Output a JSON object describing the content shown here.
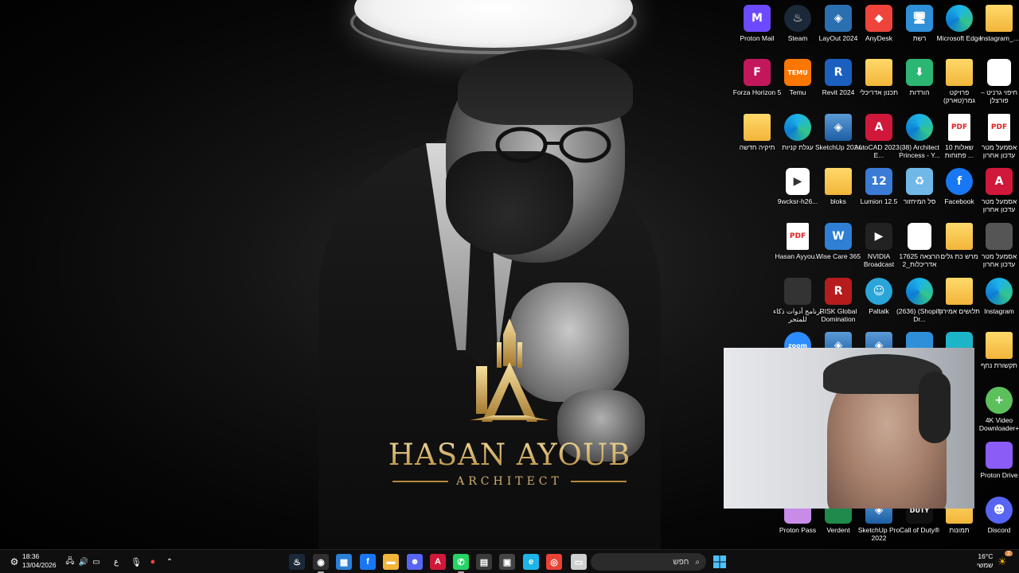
{
  "wallpaper": {
    "logo_name": "HASAN AYOUB",
    "logo_sub": "ARCHITECT",
    "accent_gold": "#d1ad6b"
  },
  "desktop_icons": [
    {
      "label": "Proton Mail",
      "icon": "proton-mail-icon",
      "color": "#6d4aff",
      "glyph": "M"
    },
    {
      "label": "Steam",
      "icon": "steam-icon",
      "color": "#1b2838",
      "glyph": "♨"
    },
    {
      "label": "LayOut 2024",
      "icon": "layout-icon",
      "color": "#2a6fb0",
      "glyph": "◈"
    },
    {
      "label": "AnyDesk",
      "icon": "anydesk-icon",
      "color": "#ef443b",
      "glyph": "◆"
    },
    {
      "label": "רשת",
      "icon": "network-icon",
      "color": "#2f8fd8",
      "glyph": "🖥"
    },
    {
      "label": "Microsoft Edge",
      "icon": "edge-icon",
      "color": "",
      "glyph": ""
    },
    {
      "label": "Instagram_...",
      "icon": "folder-icon",
      "color": "",
      "glyph": ""
    },
    {
      "label": "Forza Horizon 5",
      "icon": "forza-icon",
      "color": "#c2185b",
      "glyph": "F"
    },
    {
      "label": "Temu",
      "icon": "temu-icon",
      "color": "#fb7701",
      "glyph": "TEMU"
    },
    {
      "label": "Revit 2024",
      "icon": "revit-icon",
      "color": "#1b5fbf",
      "glyph": "R"
    },
    {
      "label": "תכנון אדריכלי",
      "icon": "folder-icon",
      "color": "",
      "glyph": ""
    },
    {
      "label": "הורדות",
      "icon": "downloads-icon",
      "color": "#2bb673",
      "glyph": "⬇"
    },
    {
      "label": "פרויקט גמר(טארק)",
      "icon": "folder-icon",
      "color": "",
      "glyph": ""
    },
    {
      "label": "חיפוי גרניט – פורצלן",
      "icon": "document-icon",
      "color": "#ffffff",
      "glyph": ""
    },
    {
      "label": "תיקיה חדשה",
      "icon": "folder-icon",
      "color": "",
      "glyph": ""
    },
    {
      "label": "עגלת קניות",
      "icon": "edge-icon",
      "color": "",
      "glyph": ""
    },
    {
      "label": "SketchUp 2024",
      "icon": "sketchup-icon",
      "color": "",
      "glyph": "◈"
    },
    {
      "label": "AutoCAD 2023 - E...",
      "icon": "autocad-icon",
      "color": "",
      "glyph": "A"
    },
    {
      "label": "(38) Architect Princess - Y...",
      "icon": "edge-icon",
      "color": "",
      "glyph": ""
    },
    {
      "label": "10 שאלות פתוחות ...",
      "icon": "pdf-icon",
      "color": "",
      "glyph": "PDF"
    },
    {
      "label": "אסמעל מטר עדכון אחרון",
      "icon": "pdf-icon",
      "color": "",
      "glyph": "PDF"
    },
    {
      "label": "9wcksr-h26...",
      "icon": "video-file-icon",
      "color": "#ffffff",
      "glyph": "▶"
    },
    {
      "label": "bloks",
      "icon": "folder-icon",
      "color": "",
      "glyph": ""
    },
    {
      "label": "Lumion 12.5",
      "icon": "lumion-icon",
      "color": "#3a7bd5",
      "glyph": "12"
    },
    {
      "label": "סל המיחזור",
      "icon": "recycle-bin-icon",
      "color": "#6fb8e8",
      "glyph": "♻"
    },
    {
      "label": "Facebook",
      "icon": "facebook-icon",
      "color": "#1877f2",
      "glyph": "f"
    },
    {
      "label": "אסמעל מטר עדכון אחרון",
      "icon": "autocad-icon",
      "color": "",
      "glyph": "A"
    },
    {
      "label": "Hasan Ayyou...",
      "icon": "pdf-icon",
      "color": "",
      "glyph": "PDF"
    },
    {
      "label": "Wise Care 365",
      "icon": "wise-care-icon",
      "color": "#2f7fd4",
      "glyph": "W"
    },
    {
      "label": "NVIDIA Broadcast",
      "icon": "nvidia-icon",
      "color": "#222222",
      "glyph": "▶"
    },
    {
      "label": "17625 הרצאה אדריכלות_2",
      "icon": "document-icon",
      "color": "#ffffff",
      "glyph": ""
    },
    {
      "label": "מרש כת גלים",
      "icon": "folder-icon",
      "color": "",
      "glyph": ""
    },
    {
      "label": "אסמעל מטר עדכון אחרון",
      "icon": "image-icon",
      "color": "#555555",
      "glyph": ""
    },
    {
      "label": "برنامج أدوات ذكاء للمتجر",
      "icon": "image-icon",
      "color": "#333333",
      "glyph": ""
    },
    {
      "label": "RISK Global Domination",
      "icon": "risk-icon",
      "color": "#b71c1c",
      "glyph": "R"
    },
    {
      "label": "Paltalk",
      "icon": "paltalk-icon",
      "color": "#2aa5d8",
      "glyph": "☺"
    },
    {
      "label": "(2636) (Shopify Dr...",
      "icon": "edge-icon",
      "color": "",
      "glyph": ""
    },
    {
      "label": "תלושים אמירה",
      "icon": "folder-icon",
      "color": "",
      "glyph": ""
    },
    {
      "label": "Instagram",
      "icon": "edge-icon",
      "color": "",
      "glyph": ""
    },
    {
      "label": "",
      "icon": "zoom-icon",
      "color": "#2d8cff",
      "glyph": "zoom"
    },
    {
      "label": "",
      "icon": "sketchup-icon",
      "color": "",
      "glyph": "◈"
    },
    {
      "label": "",
      "icon": "sketchup-icon",
      "color": "",
      "glyph": "◈"
    },
    {
      "label": "",
      "icon": "network-icon",
      "color": "#2f8fd8",
      "glyph": ""
    },
    {
      "label": "",
      "icon": "app-icon",
      "color": "#1cb5c8",
      "glyph": ""
    },
    {
      "label": "תקשורת נחף",
      "icon": "folder-icon",
      "color": "",
      "glyph": ""
    },
    {
      "label": "4K Video Downloader+",
      "icon": "4k-downloader-icon",
      "color": "#5cc05c",
      "glyph": "+"
    },
    {
      "label": "Proton Drive",
      "icon": "proton-drive-icon",
      "color": "#8b5cf6",
      "glyph": ""
    },
    {
      "label": "Proton Pass",
      "icon": "proton-pass-icon",
      "color": "#c88ce8",
      "glyph": ""
    },
    {
      "label": "Verdent",
      "icon": "verdent-icon",
      "color": "#1f8a4c",
      "glyph": ""
    },
    {
      "label": "SketchUp Pro 2022",
      "icon": "sketchup-icon",
      "color": "",
      "glyph": "◈"
    },
    {
      "label": "Call of Duty®",
      "icon": "cod-icon",
      "color": "#111111",
      "glyph": "DUTY"
    },
    {
      "label": "תמונות",
      "icon": "folder-icon",
      "color": "",
      "glyph": ""
    },
    {
      "label": "Discord",
      "icon": "discord-icon",
      "color": "#5865f2",
      "glyph": "☻"
    }
  ],
  "taskbar": {
    "clock_time": "18:36",
    "clock_date": "13/04/2026",
    "search_placeholder": "חפש",
    "weather_temp": "16°C",
    "weather_text": "שמשי",
    "weather_badge": "2",
    "lang": "ع",
    "pinned": [
      {
        "name": "taskbar-steam",
        "icon": "steam-icon",
        "color": "#1b2838",
        "glyph": "♨"
      },
      {
        "name": "taskbar-obs",
        "icon": "obs-icon",
        "color": "#302e31",
        "glyph": "◉"
      },
      {
        "name": "taskbar-app",
        "icon": "app-icon",
        "color": "#2a7fd6",
        "glyph": "▦"
      },
      {
        "name": "taskbar-facebook",
        "icon": "facebook-icon",
        "color": "#1877f2",
        "glyph": "f"
      },
      {
        "name": "taskbar-explorer",
        "icon": "file-explorer-icon",
        "color": "#f2b53a",
        "glyph": "▬"
      },
      {
        "name": "taskbar-discord",
        "icon": "discord-icon",
        "color": "#5865f2",
        "glyph": "☻"
      },
      {
        "name": "taskbar-autocad",
        "icon": "autocad-icon",
        "color": "#d0183a",
        "glyph": "A"
      },
      {
        "name": "taskbar-whatsapp",
        "icon": "whatsapp-icon",
        "color": "#25d366",
        "glyph": "✆"
      },
      {
        "name": "taskbar-calculator",
        "icon": "calculator-icon",
        "color": "#3a3a3a",
        "glyph": "▤"
      },
      {
        "name": "taskbar-store",
        "icon": "store-icon",
        "color": "#444444",
        "glyph": "▣"
      },
      {
        "name": "taskbar-edge",
        "icon": "edge-icon",
        "color": "#1db4e8",
        "glyph": "e"
      },
      {
        "name": "taskbar-chrome",
        "icon": "chrome-icon",
        "color": "#e94235",
        "glyph": "◎"
      },
      {
        "name": "taskbar-notepad",
        "icon": "notepad-icon",
        "color": "#cfcfcf",
        "glyph": "▭"
      }
    ]
  }
}
